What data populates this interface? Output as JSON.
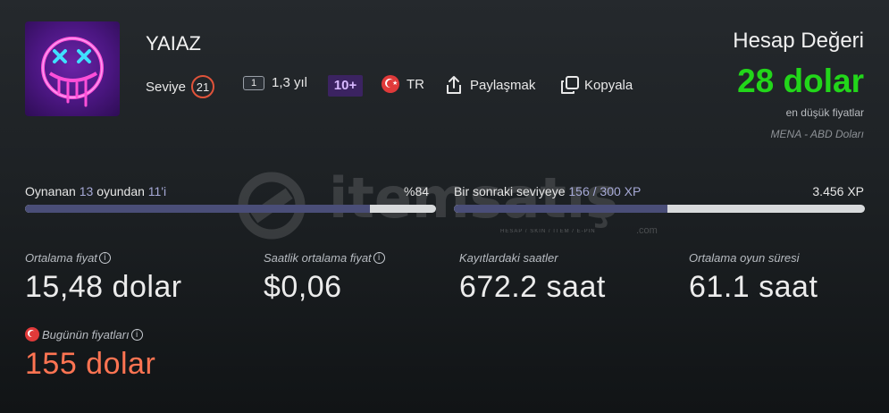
{
  "profile": {
    "username": "YAIAZ",
    "level_label": "Seviye",
    "level_value": "21",
    "years": "1,3 yıl",
    "years_icon": "1",
    "badge": "10+",
    "country": "TR",
    "share_label": "Paylaşmak",
    "copy_label": "Kopyala"
  },
  "account_value": {
    "label": "Hesap Değeri",
    "value": "28 dolar",
    "sub": "en düşük fiyatlar",
    "region": "MENA - ABD Doları"
  },
  "progress_games": {
    "prefix": "Oynanan",
    "played": "13",
    "mid": "oyundan",
    "total": "11'i",
    "percent_label": "%84",
    "fraction": 0.84
  },
  "progress_level": {
    "prefix": "Bir sonraki seviyeye",
    "xp": "156 / 300 XP",
    "total_xp": "3.456 XP",
    "fraction": 0.52
  },
  "stats": {
    "avg_price_label": "Ortalama fiyat",
    "avg_price_value": "15,48 dolar",
    "hourly_label": "Saatlik ortalama fiyat",
    "hourly_value": "$0,06",
    "recorded_label": "Kayıtlardaki saatler",
    "recorded_value": "672.2 saat",
    "avg_play_label": "Ortalama oyun süresi",
    "avg_play_value": "61.1 saat",
    "today_label": "Bugünün fiyatları",
    "today_value": "155 dolar"
  },
  "icons": {
    "share": "share-icon",
    "copy": "copy-icon",
    "info": "info-icon",
    "flag": "turkey-flag-icon"
  },
  "colors": {
    "green": "#22d61a",
    "orange": "#ff7452",
    "level_ring": "#e0533a",
    "bar_fill": "#4a4e78"
  },
  "watermark": {
    "text": "itemsatış",
    "sub": "HESAP / SKIN / ITEM / E-PIN",
    "domain": ".com"
  }
}
